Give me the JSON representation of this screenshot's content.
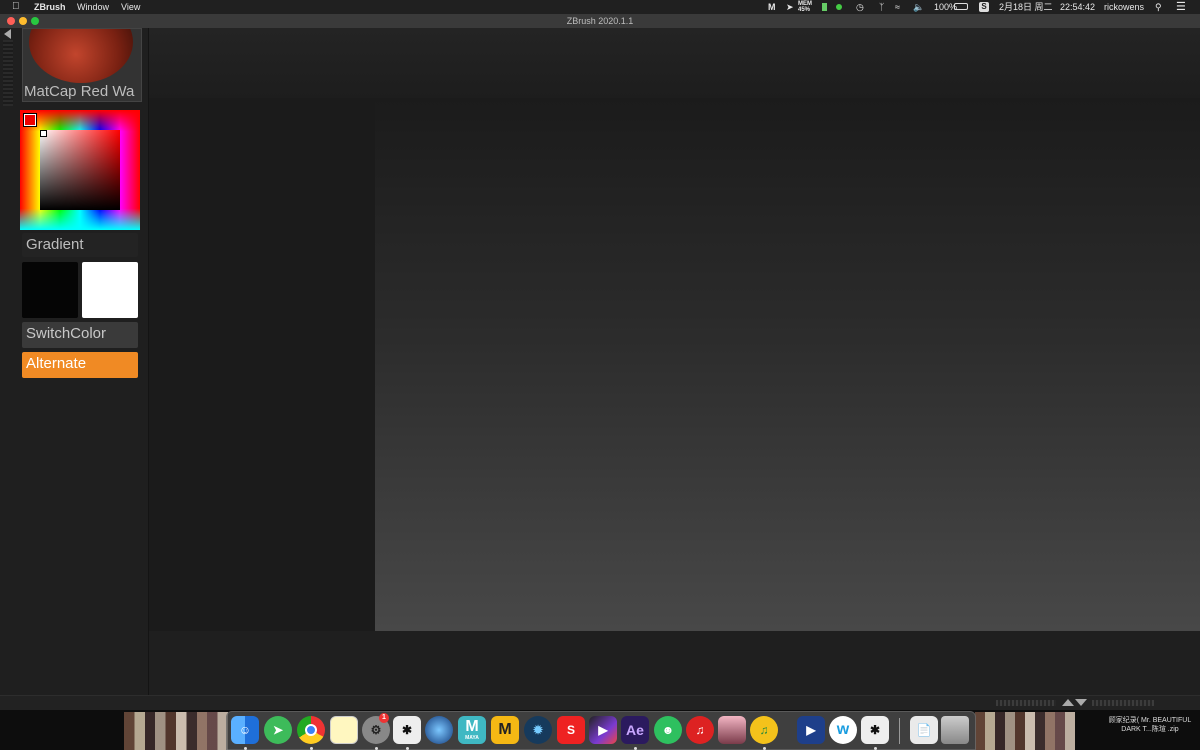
{
  "menubar": {
    "apple_icon": "apple-icon",
    "app_name": "ZBrush",
    "menus": [
      "Window",
      "View"
    ],
    "status": {
      "mem_label": "MEM",
      "mem_value": "45%",
      "battery": "100%",
      "date": "2月18日 周二",
      "time": "22:54:42",
      "user": "rickowens"
    }
  },
  "window": {
    "title": "ZBrush 2020.1.1",
    "close_color": "#ff5f57",
    "minimize_color": "#febc2e",
    "zoom_color": "#28c840"
  },
  "tray": {
    "material_label": "MatCap Red Wa",
    "gradient_label": "Gradient",
    "switchcolor_label": "SwitchColor",
    "alternate_label": "Alternate",
    "main_color": "#050505",
    "secondary_color": "#ffffff",
    "accent_color": "#f08a24"
  },
  "dock": {
    "badge": "1",
    "ae_label": "Ae",
    "maya_label": "M",
    "maya_sub": "MAYA",
    "m_label": "M"
  },
  "desktop": {
    "file_line1": "顾家纪录( Mr. BEAUTIFUL",
    "file_line2": "DARK T...陈瑄 .zip"
  }
}
